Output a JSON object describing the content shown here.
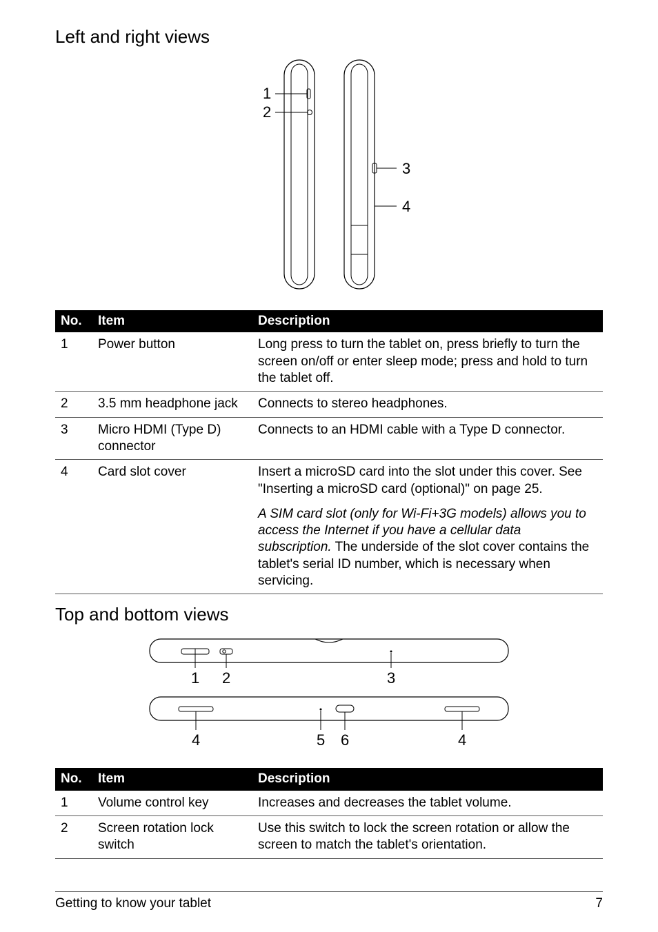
{
  "section1": {
    "heading": "Left and right views",
    "headers": {
      "no": "No.",
      "item": "Item",
      "desc": "Description"
    },
    "rows": [
      {
        "no": "1",
        "item": "Power button",
        "desc": "Long press to turn the tablet on, press briefly to turn the screen on/off or enter sleep mode; press and hold to turn the tablet off."
      },
      {
        "no": "2",
        "item": "3.5 mm headphone jack",
        "desc": "Connects to stereo headphones."
      },
      {
        "no": "3",
        "item": "Micro HDMI (Type D) connector",
        "desc": "Connects to an HDMI cable with a Type D connector."
      },
      {
        "no": "4",
        "item": "Card slot cover",
        "desc": "Insert a microSD card into the slot under this cover. See \"Inserting a microSD card (optional)\" on page 25."
      }
    ],
    "row4_extra_italic": "A SIM card slot (only for Wi-Fi+3G models) allows you to access the Internet if you have a cellular data subscription.",
    "row4_extra_plain": " The underside of the slot cover contains the tablet's serial ID number, which is necessary when servicing."
  },
  "section2": {
    "heading": "Top and bottom views",
    "headers": {
      "no": "No.",
      "item": "Item",
      "desc": "Description"
    },
    "rows": [
      {
        "no": "1",
        "item": "Volume control key",
        "desc": "Increases and decreases the tablet volume."
      },
      {
        "no": "2",
        "item": "Screen rotation lock switch",
        "desc": "Use this switch to lock the screen rotation or allow the screen to match the tablet's orientation."
      }
    ]
  },
  "footer": {
    "left": "Getting to know your tablet",
    "right": "7"
  },
  "diagram1_labels": {
    "l1": "1",
    "l2": "2",
    "l3": "3",
    "l4": "4"
  },
  "diagram2_labels": {
    "l1": "1",
    "l2": "2",
    "l3": "3",
    "l4a": "4",
    "l5": "5",
    "l6": "6",
    "l4b": "4"
  }
}
